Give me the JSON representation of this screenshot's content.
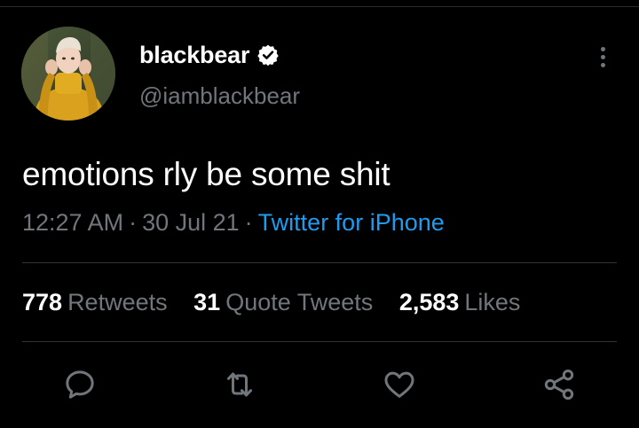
{
  "user": {
    "display_name": "blackbear",
    "handle": "@iamblackbear",
    "verified": true
  },
  "tweet": {
    "text": "emotions rly be some shit",
    "time": "12:27 AM",
    "date": "30 Jul 21",
    "separator": "·",
    "source": "Twitter for iPhone"
  },
  "stats": {
    "retweets": {
      "count": "778",
      "label": "Retweets"
    },
    "quotes": {
      "count": "31",
      "label": "Quote Tweets"
    },
    "likes": {
      "count": "2,583",
      "label": "Likes"
    }
  },
  "icons": {
    "more": "more-vertical-icon",
    "reply": "reply-icon",
    "retweet": "retweet-icon",
    "like": "heart-icon",
    "share": "share-icon",
    "verified": "verified-badge-icon"
  },
  "colors": {
    "background": "#000000",
    "primary_text": "#ffffff",
    "secondary_text": "#71767b",
    "link": "#1d9bf0",
    "divider": "#2f3336"
  }
}
